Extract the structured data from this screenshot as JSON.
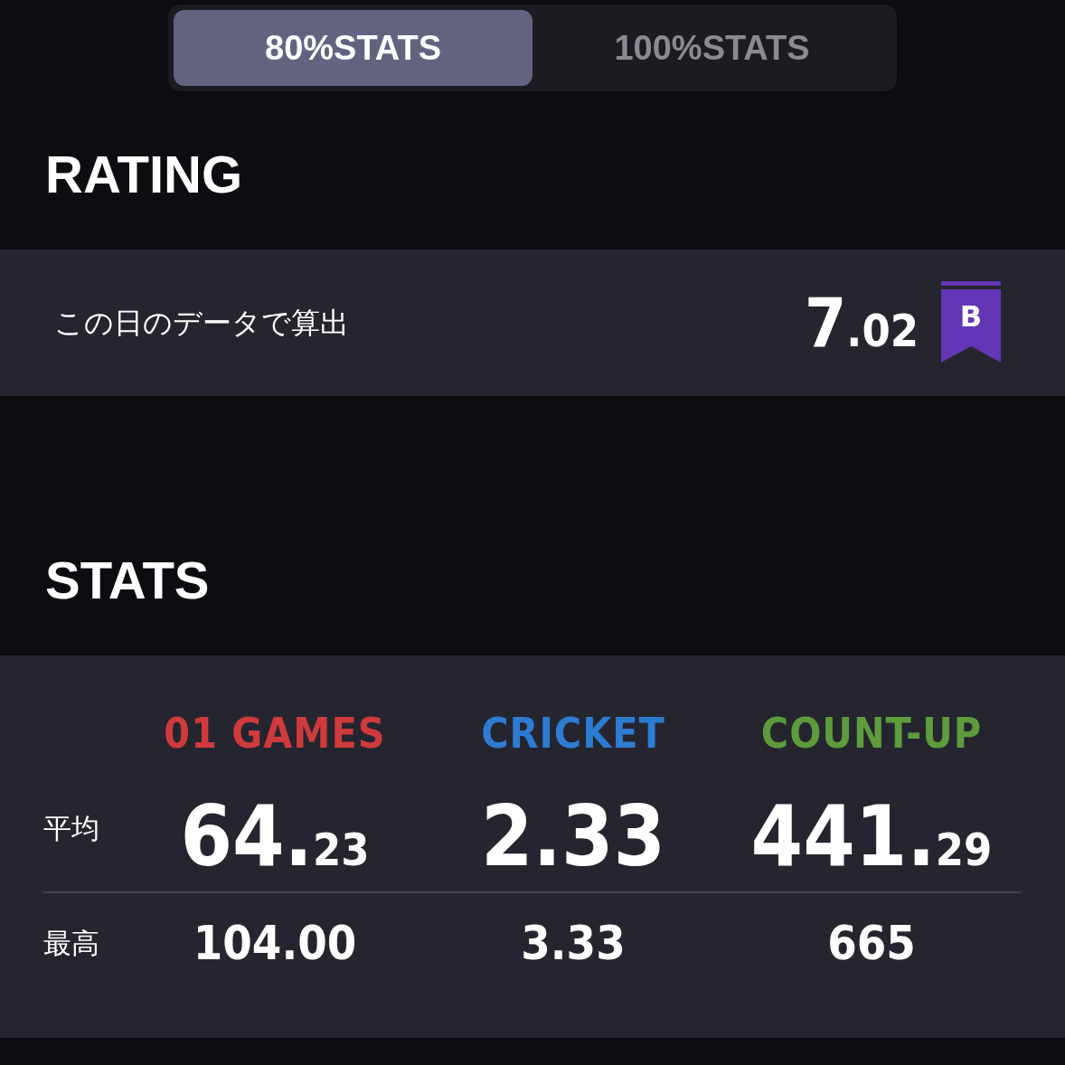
{
  "tabs": [
    {
      "label": "80%STATS",
      "selected": true
    },
    {
      "label": "100%STATS",
      "selected": false
    }
  ],
  "rating": {
    "heading": "RATING",
    "note": "この日のデータで算出",
    "value_main": "7",
    "value_decimal": ".02",
    "badge": {
      "letter": "B",
      "color": "#6236b4"
    }
  },
  "stats": {
    "heading": "STATS",
    "columns": [
      {
        "label": "01 GAMES",
        "color": "#cf3a3c"
      },
      {
        "label": "CRICKET",
        "color": "#2e7bd2"
      },
      {
        "label": "COUNT-UP",
        "color": "#5e9b3c"
      }
    ],
    "rows": [
      {
        "label": "平均",
        "kind": "big",
        "values": [
          {
            "main": "64.",
            "decimal": "23"
          },
          {
            "main": "2.33"
          },
          {
            "main": "441.",
            "decimal": "29"
          }
        ]
      },
      {
        "label": "最高",
        "kind": "small",
        "values": [
          {
            "main": "104.00"
          },
          {
            "main": "3.33"
          },
          {
            "main": "665"
          }
        ]
      }
    ]
  }
}
